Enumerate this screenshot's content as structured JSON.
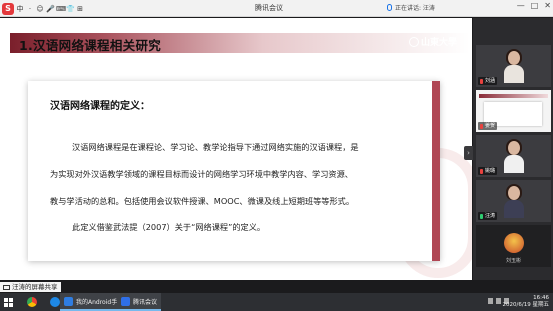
{
  "window": {
    "title": "腾讯会议",
    "speaking_label": "正在讲话: 汪涛",
    "controls": [
      "—",
      "□",
      "✕"
    ]
  },
  "ime_toolbar": {
    "logo": "S",
    "items": [
      "中",
      "·",
      "☺",
      "🎤",
      "⌨",
      "👕",
      "⊞"
    ]
  },
  "slide": {
    "title": "1.汉语网络课程相关研究",
    "logo_text": "山東大學",
    "heading": "汉语网络课程的定义：",
    "lines": [
      "汉语网络课程是在课程论、学习论、教学论指导下通过网络实施的汉语课程，是",
      "为实现对外汉语教学领域的课程目标而设计的网络学习环境中教学内容、学习资源、",
      "教与学活动的总和。包括使用会议软件授课、MOOC、微课及线上短期班等等形式。",
      "此定义借鉴武法提（2007）关于“网络课程”的定义。"
    ]
  },
  "participants": [
    {
      "name": "刘涵",
      "kind": "video"
    },
    {
      "name": "姜贺",
      "kind": "slide"
    },
    {
      "name": "姚璐",
      "kind": "video"
    },
    {
      "name": "汪涛",
      "kind": "video"
    },
    {
      "name": "刘玉彬",
      "kind": "avatar"
    }
  ],
  "sharing_indicator": "汪涛的屏幕共享",
  "taskbar": {
    "apps": [
      {
        "label": "我的Android手机",
        "color": "#2f7de1"
      },
      {
        "label": "腾讯会议",
        "color": "#2f6fe8"
      }
    ],
    "time": "16:46",
    "date": "2020/6/19 星期五"
  },
  "colors": {
    "accent": "#b04654",
    "title_bar_start": "#7a1f2b",
    "taskbar": "#2d2f33"
  }
}
